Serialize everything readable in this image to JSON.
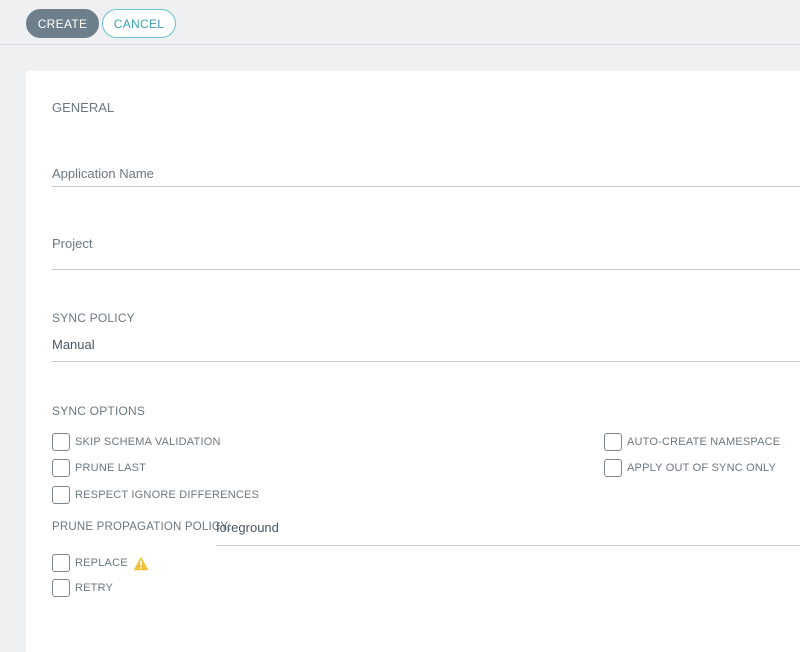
{
  "toolbar": {
    "create_label": "CREATE",
    "cancel_label": "CANCEL"
  },
  "general": {
    "heading": "GENERAL",
    "application_name_label": "Application Name",
    "project_label": "Project"
  },
  "sync_policy": {
    "heading": "SYNC POLICY",
    "value": "Manual"
  },
  "sync_options": {
    "heading": "SYNC OPTIONS",
    "skip_schema_validation": "SKIP SCHEMA VALIDATION",
    "prune_last": "PRUNE LAST",
    "respect_ignore_differences": "RESPECT IGNORE DIFFERENCES",
    "auto_create_namespace": "AUTO-CREATE NAMESPACE",
    "apply_out_of_sync_only": "APPLY OUT OF SYNC ONLY",
    "prune_propagation_policy_label": "PRUNE PROPAGATION POLICY:",
    "prune_propagation_policy_value": "foreground",
    "replace": "REPLACE",
    "retry": "RETRY"
  },
  "colors": {
    "warning_icon": "#f2c037",
    "accent": "#6cc1cf"
  },
  "icons": {
    "replace_warning": "warning-triangle-icon"
  }
}
